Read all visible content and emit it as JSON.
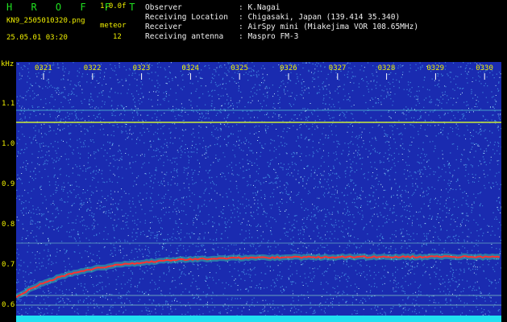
{
  "header": {
    "app_title": "H R O F F T",
    "version": "1.0.0f",
    "filename": "KN9_2505010320.png",
    "meteor_label": "meteor",
    "timestamp": "25.05.01 03:20",
    "count": "12",
    "info_labels": [
      "Observer",
      "Receiving Location",
      "Receiver",
      "Receiving antenna"
    ],
    "info_values": [
      ": K.Nagai",
      ": Chigasaki, Japan (139.414 35.340)",
      ": AirSpy mini (Miakejima VOR 108.65MHz)",
      ": Maspro FM-3"
    ]
  },
  "spectrogram": {
    "y_unit": "kHz",
    "y_ticks": [
      "1.1",
      "1.0",
      "0.9",
      "0.8",
      "0.7",
      "0.6"
    ],
    "time_labels": [
      "0321",
      "0322",
      "0323",
      "0324",
      "0325",
      "0326",
      "0327",
      "0328",
      "0329",
      "0330"
    ],
    "colors": {
      "background": "#1a2bb0",
      "trace": "#ff3030",
      "label": "#f0f000",
      "info": "#f0f0f0",
      "title": "#20e020"
    }
  }
}
